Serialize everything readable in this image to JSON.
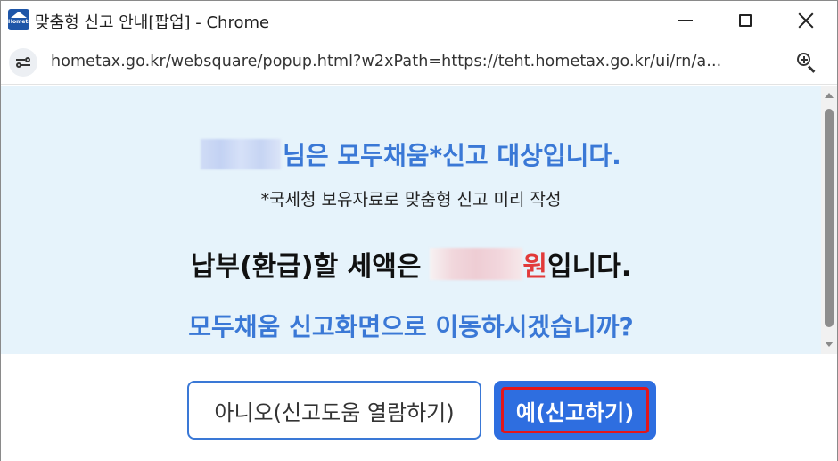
{
  "window": {
    "title": "맞춤형 신고 안내[팝업] - Chrome",
    "app_icon_text": "Hometax"
  },
  "address_bar": {
    "url": "hometax.go.kr/websquare/popup.html?w2xPath=https://teht.hometax.go.kr/ui/rn/a..."
  },
  "content": {
    "headline_suffix": "님은 모두채움*신고 대상입니다.",
    "footnote": "*국세청 보유자료로 맞춤형 신고 미리 작성",
    "tax_prefix": "납부(환급)할 세액은",
    "currency_unit": "원",
    "tax_suffix": "입니다.",
    "question": "모두채움 신고화면으로 이동하시겠습니까?"
  },
  "buttons": {
    "no_label": "아니오(신고도움 열람하기)",
    "yes_label": "예(신고하기)"
  },
  "colors": {
    "accent_blue": "#3a78d6",
    "primary_button": "#2e6ee0",
    "highlight_red": "#e23a3a",
    "content_bg": "#e6f3fb"
  }
}
